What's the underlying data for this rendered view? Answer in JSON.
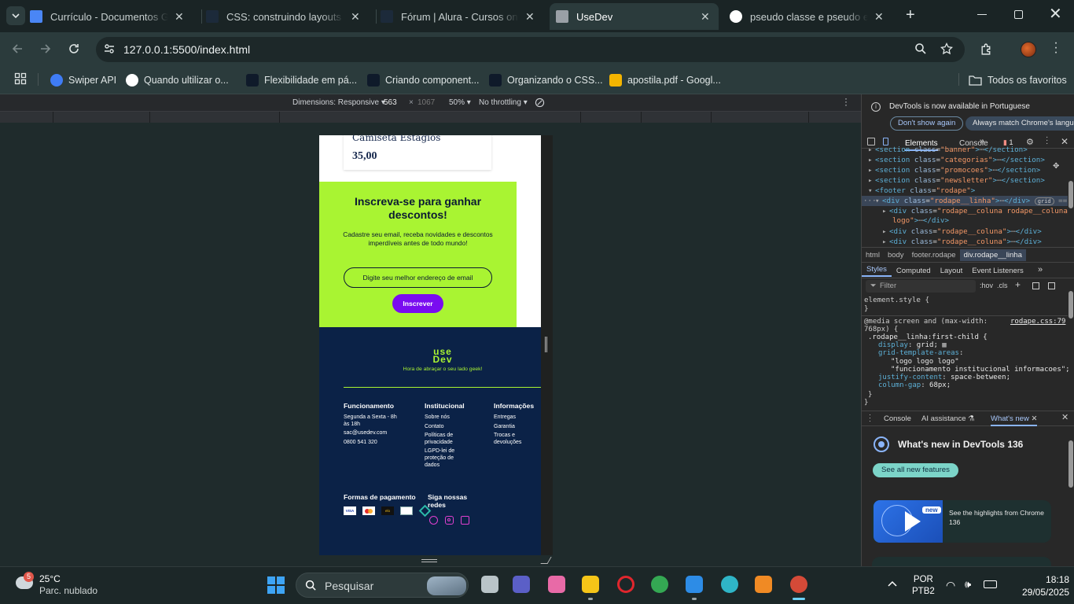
{
  "tabs": [
    {
      "label": "Currículo - Documentos Goo",
      "color": "#4a86f5"
    },
    {
      "label": "CSS: construindo layouts res",
      "color": "#1c2a3a"
    },
    {
      "label": "Fórum | Alura - Cursos onlin",
      "color": "#1c2a3a"
    },
    {
      "label": "UseDev",
      "color": "#9aa0a6"
    },
    {
      "label": "pseudo classe e pseudo elem",
      "color": "#ffffff"
    }
  ],
  "address": "127.0.0.1:5500/index.html",
  "bookmarks": [
    {
      "label": "Swiper API",
      "color": "#3f7cf5"
    },
    {
      "label": "Quando ultilizar o...",
      "color": "#ffffff"
    },
    {
      "label": "Flexibilidade em pá...",
      "color": "#0f1a2a"
    },
    {
      "label": "Criando component...",
      "color": "#0f1a2a"
    },
    {
      "label": "Organizando o CSS...",
      "color": "#0f1a2a"
    },
    {
      "label": "apostila.pdf - Googl...",
      "color": "#f4b400"
    }
  ],
  "all_bookmarks": "Todos os favoritos",
  "device": {
    "dimensions": "Dimensions: Responsive",
    "width": "563",
    "x": "×",
    "height": "1067",
    "zoom": "50%",
    "throttle": "No throttling"
  },
  "site": {
    "product_name": "Camiseta Estágios",
    "price": "35,00",
    "newsletter_title": "Inscreva-se para ganhar descontos!",
    "newsletter_text": "Cadastre seu email, receba novidades e descontos imperdíveis antes de todo mundo!",
    "email_placeholder": "Digite seu melhor endereço de email",
    "subscribe": "Inscrever",
    "logo_top": "use",
    "logo_bottom": "Dev",
    "slogan": "Hora de abraçar o seu lado geek!",
    "col1_title": "Funcionamento",
    "col1_items": [
      "Segunda a Sexta - 8h às 18h",
      "sac@usedev.com",
      "0800 541 320"
    ],
    "col2_title": "Institucional",
    "col2_items": [
      "Sobre nós",
      "Contato",
      "Políticas de privacidade",
      "LGPD-lei de proteção de dados"
    ],
    "col3_title": "Informações",
    "col3_items": [
      "Entregas",
      "Garantia",
      "Trocas e devoluções"
    ],
    "payment_title": "Formas de pagamento",
    "social_title": "Siga nossas redes",
    "payment_badges": [
      "VISA",
      "",
      "elo",
      "",
      ""
    ]
  },
  "devtools": {
    "banner": "DevTools is now available in Portuguese",
    "dont_show": "Don't show again",
    "always_match": "Always match Chrome's language",
    "tab_elements": "Elements",
    "tab_console": "Console",
    "issues": "1",
    "dom_lines": [
      {
        "indent": 1,
        "tag": "section",
        "cls": "banner",
        "partial": true
      },
      {
        "indent": 1,
        "tag": "section",
        "cls": "categorias"
      },
      {
        "indent": 1,
        "tag": "section",
        "cls": "promocoes"
      },
      {
        "indent": 1,
        "tag": "section",
        "cls": "newsletter"
      },
      {
        "indent": 1,
        "tag": "footer",
        "cls": "rodape",
        "open": true
      },
      {
        "indent": 2,
        "tag": "div",
        "cls": "rodape__linha",
        "selected": true
      },
      {
        "indent": 3,
        "tag": "div",
        "cls": "rodape__coluna rodape__coluna_",
        "cont": "logo"
      },
      {
        "indent": 3,
        "tag": "div",
        "cls": "rodape__coluna"
      },
      {
        "indent": 3,
        "tag": "div",
        "cls": "rodape__coluna"
      }
    ],
    "grid_badge": "grid",
    "selected_marker": "== $0",
    "breadcrumbs": [
      "html",
      "body",
      "footer.rodape",
      "div.rodape__linha"
    ],
    "style_tabs": [
      "Styles",
      "Computed",
      "Layout",
      "Event Listeners"
    ],
    "filter_placeholder": "Filter",
    "hov": ":hov",
    "cls": ".cls",
    "element_style": "element.style {",
    "media": "@media screen and (max-width: 768px) {",
    "source": "rodape.css:79",
    "selector": ".rodape__linha:first-child {",
    "decls": [
      {
        "p": "display",
        "v": "grid;"
      },
      {
        "p": "grid-template-areas",
        "v": ""
      },
      {
        "p": "",
        "v": "\"logo logo logo\""
      },
      {
        "p": "",
        "v": "\"funcionamento institucional informacoes\";"
      },
      {
        "p": "justify-content",
        "v": "space-between;"
      },
      {
        "p": "column-gap",
        "v": "68px;"
      }
    ],
    "drawer_tabs": [
      "Console",
      "AI assistance",
      "What's new"
    ],
    "whats_new_title": "What's new in DevTools 136",
    "see_all": "See all new features",
    "new_badge": "new",
    "highlights": "See the highlights from Chrome 136"
  },
  "taskbar": {
    "weather_temp": "25°C",
    "weather_desc": "Parc. nublado",
    "weather_badge": "5",
    "search": "Pesquisar",
    "lang1": "POR",
    "lang2": "PTB2",
    "time": "18:18",
    "date": "29/05/2025"
  }
}
